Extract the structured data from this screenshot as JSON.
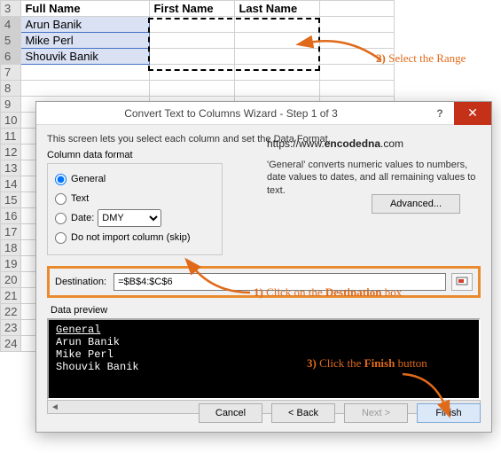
{
  "sheet": {
    "headers": [
      "Full Name",
      "First Name",
      "Last Name"
    ],
    "rows": [
      "Arun Banik",
      "Mike Perl",
      "Shouvik Banik"
    ],
    "rownums": [
      "3",
      "4",
      "5",
      "6",
      "7",
      "8",
      "9",
      "10",
      "11",
      "12",
      "13",
      "14",
      "15",
      "16",
      "17",
      "18",
      "19",
      "20",
      "21",
      "22",
      "23",
      "24"
    ]
  },
  "dialog": {
    "title": "Convert Text to Columns Wizard - Step 1 of 3",
    "help": "?",
    "close": "✕",
    "intro": "This screen lets you select each column and set the Data Format.",
    "fmt_header": "Column data format",
    "opt_general": "General",
    "opt_text": "Text",
    "opt_date": "Date:",
    "date_fmt": "DMY",
    "opt_skip": "Do not import column (skip)",
    "url_pre": "https://www.",
    "url_bold": "encodedna",
    "url_post": ".com",
    "desc": "'General' converts numeric values to numbers, date values to dates, and all remaining values to text.",
    "advanced": "Advanced...",
    "dest_label": "Destination:",
    "dest_value": "=$B$4:$C$6",
    "preview_label": "Data preview",
    "preview_header": "General",
    "preview_lines": [
      "Arun Banik",
      "Mike Perl",
      "Shouvik Banik"
    ],
    "btn_cancel": "Cancel",
    "btn_back": "< Back",
    "btn_next": "Next >",
    "btn_finish": "Finish"
  },
  "anno": {
    "a1_prefix": "1)",
    "a1_pre": " Click on the ",
    "a1_bold": "Destination",
    "a1_post": " box",
    "a2_prefix": "2)",
    "a2_text": " Select the Range",
    "a3_prefix": "3)",
    "a3_pre": " Click the ",
    "a3_bold": "Finish",
    "a3_post": " button"
  }
}
